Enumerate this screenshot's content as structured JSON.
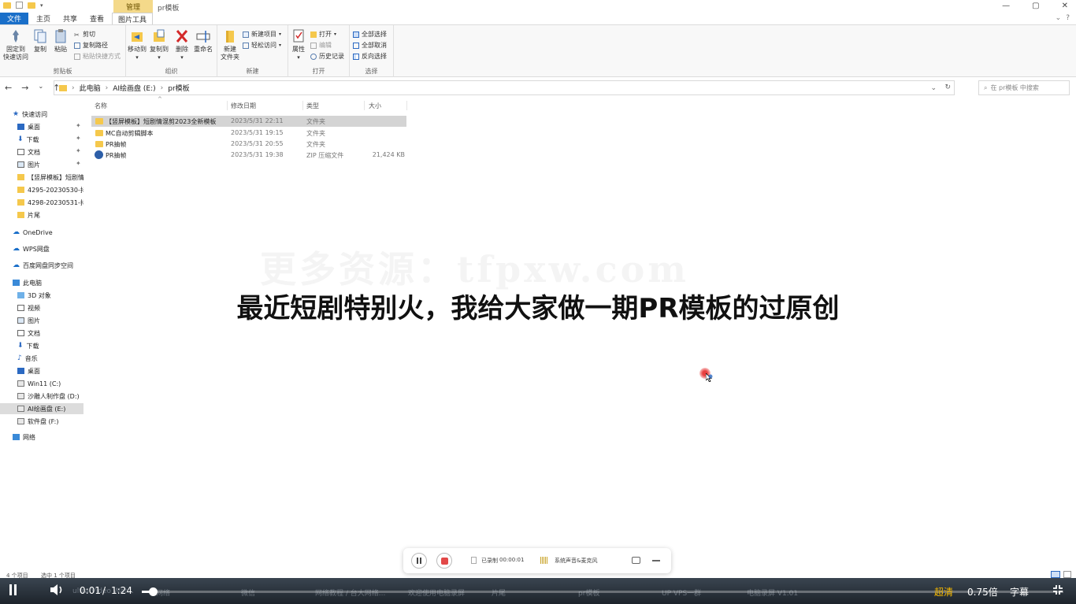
{
  "window": {
    "title": "pr模板",
    "context_tab": "管理"
  },
  "ribbon_tabs": [
    "文件",
    "主页",
    "共享",
    "查看",
    "图片工具"
  ],
  "ribbon": {
    "clipboard": {
      "label": "剪贴板",
      "pin_label_1": "固定到",
      "pin_label_2": "快速访问",
      "copy": "复制",
      "paste": "粘贴",
      "cut": "剪切",
      "copy_path": "复制路径",
      "paste_shortcut": "粘贴快捷方式"
    },
    "organize": {
      "label": "组织",
      "move_to": "移动到",
      "copy_to": "复制到",
      "delete": "删除",
      "rename": "重命名"
    },
    "new": {
      "label": "新建",
      "new_folder_1": "新建",
      "new_folder_2": "文件夹",
      "new_item": "新建项目",
      "easy_access": "轻松访问"
    },
    "open": {
      "label": "打开",
      "properties": "属性",
      "open": "打开",
      "edit": "编辑",
      "history": "历史记录"
    },
    "select": {
      "label": "选择",
      "select_all": "全部选择",
      "select_none": "全部取消",
      "invert": "反向选择"
    }
  },
  "address": {
    "crumbs": [
      "此电脑",
      "AI绘画盘 (E:)",
      "pr模板"
    ],
    "search_placeholder": "在 pr模板 中搜索"
  },
  "nav": {
    "quick_access": "快速访问",
    "quick_items": [
      "桌面",
      "下载",
      "文档",
      "图片",
      "【竖屏模板】短剧情",
      "4295-20230530-抖",
      "4298-20230531-抖",
      "片尾"
    ],
    "onedrive": "OneDrive",
    "wps": "WPS网盘",
    "baidu": "百度网盘同步空间",
    "this_pc": "此电脑",
    "pc_items": [
      "3D 对象",
      "视频",
      "图片",
      "文档",
      "下载",
      "音乐",
      "桌面"
    ],
    "drives": [
      "Win11 (C:)",
      "沙雕人制作盘 (D:)",
      "AI绘画盘 (E:)",
      "软件盘 (F:)"
    ],
    "network": "网络"
  },
  "file_list": {
    "headers": {
      "name": "名称",
      "date": "修改日期",
      "type": "类型",
      "size": "大小"
    },
    "rows": [
      {
        "name": "【竖屏模板】短剧情混剪2023全新模板",
        "date": "2023/5/31 22:11",
        "type": "文件夹",
        "size": ""
      },
      {
        "name": "MC自动剪辑脚本",
        "date": "2023/5/31 19:15",
        "type": "文件夹",
        "size": ""
      },
      {
        "name": "PR抽帧",
        "date": "2023/5/31 20:55",
        "type": "文件夹",
        "size": ""
      },
      {
        "name": "PR抽帧",
        "date": "2023/5/31 19:38",
        "type": "ZIP 压缩文件",
        "size": "21,424 KB"
      }
    ]
  },
  "watermark": "更多资源：tfpxw.com",
  "subtitle": "最近短剧特别火，我给大家做一期PR模板的过原创",
  "recorder": {
    "recorded_label": "已录制",
    "recorded_time": "00:00:01",
    "audio_label": "系统声音&麦克风"
  },
  "status": {
    "count": "4 个项目",
    "selected": "选中 1 个项目"
  },
  "taskbar_ghost": [
    "ultra Video Wat...",
    "网络",
    "微信",
    "网络教程 / 台大网络...",
    "欢迎使用电脑录屏",
    "片尾",
    "pr模板",
    "UP VPS一群",
    "电脑录屏 V1.01"
  ],
  "player": {
    "current_time": "0:01",
    "separator": "/",
    "duration": "1:24",
    "progress": 0.012,
    "quality": "超清",
    "speed": "0.75倍",
    "caption": "字幕"
  },
  "colors": {
    "accent": "#1a6fc9",
    "folder": "#f5c84c",
    "record": "#e24848",
    "quality": "#f5b800"
  }
}
